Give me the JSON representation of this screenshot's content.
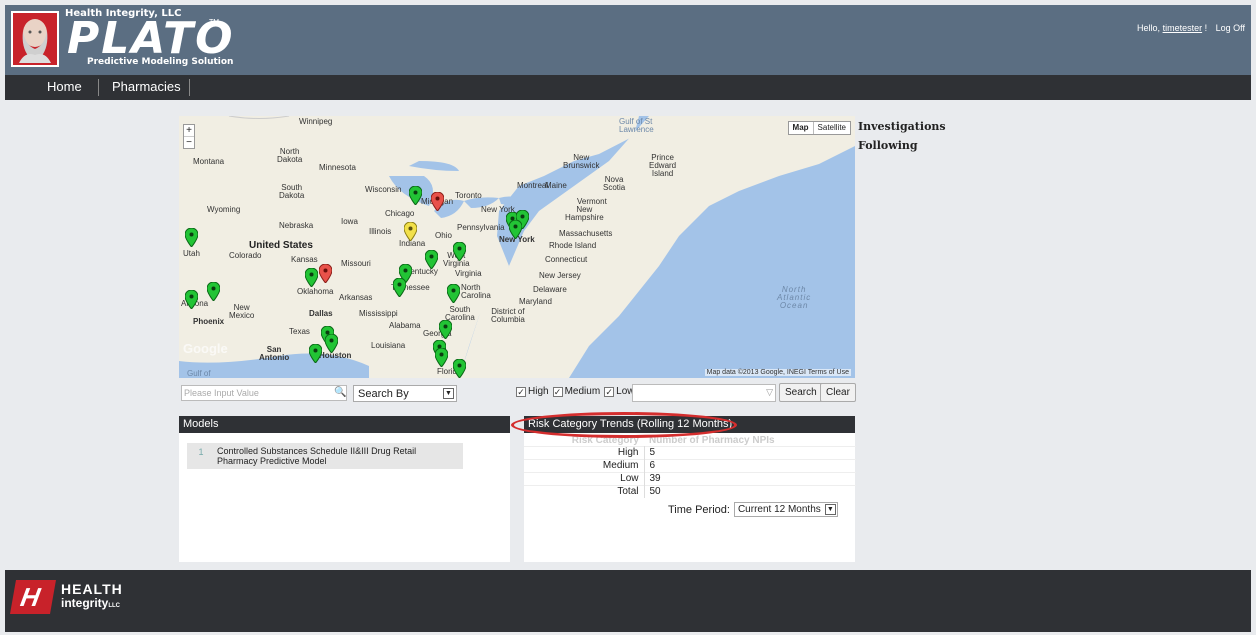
{
  "header": {
    "company": "Health Integrity, LLC",
    "brand": "PLATO",
    "tm": "TM",
    "tagline": "Predictive Modeling Solution",
    "greeting": "Hello,",
    "username": "timetester",
    "exclaim": "!",
    "logoff": "Log Off"
  },
  "nav": {
    "items": [
      "Home",
      "Pharmacies"
    ]
  },
  "map": {
    "type_buttons": [
      "Map",
      "Satellite"
    ],
    "zoom_in": "+",
    "zoom_out": "−",
    "attribution": "Map data ©2013 Google, INEGI    Terms of Use",
    "google": "Google",
    "labels": {
      "winnipeg": "Winnipeg",
      "gulf_st_lawrence": "Gulf of St\nLawrence",
      "north_dakota": "North\nDakota",
      "montana": "Montana",
      "minnesota": "Minnesota",
      "south_dakota": "South\nDakota",
      "wisconsin": "Wisconsin",
      "michigan": "Michigan",
      "toronto": "Toronto",
      "montreal": "Montreal",
      "maine": "Maine",
      "new_brunswick": "New\nBrunswick",
      "pei": "Prince\nEdward\nIsland",
      "nova_scotia": "Nova\nScotia",
      "wyoming": "Wyoming",
      "iowa": "Iowa",
      "nebraska": "Nebraska",
      "chicago": "Chicago",
      "illinois": "Illinois",
      "indiana": "Indiana",
      "ohio": "Ohio",
      "pennsylvania": "Pennsylvania",
      "new_york_state": "New York",
      "vermont": "Vermont",
      "new_hampshire": "New\nHampshire",
      "massachusetts": "Massachusetts",
      "rhode_island": "Rhode Island",
      "connecticut": "Connecticut",
      "new_jersey": "New Jersey",
      "delaware": "Delaware",
      "maryland": "Maryland",
      "dc": "District of\nColumbia",
      "new_york_city": "New York",
      "united_states": "United States",
      "utah": "Utah",
      "colorado": "Colorado",
      "kansas": "Kansas",
      "missouri": "Missouri",
      "kentucky": "Kentucky",
      "west_virginia": "West\nVirginia",
      "virginia": "Virginia",
      "oklahoma": "Oklahoma",
      "arkansas": "Arkansas",
      "tennessee": "Tennessee",
      "north_carolina": "North\nCarolina",
      "south_carolina": "South\nCarolina",
      "arizona": "Arizona",
      "new_mexico": "New\nMexico",
      "phoenix": "Phoenix",
      "dallas": "Dallas",
      "mississippi": "Mississippi",
      "alabama": "Alabama",
      "georgia": "Georgia",
      "texas": "Texas",
      "louisiana": "Louisiana",
      "san_antonio": "San\nAntonio",
      "houston": "Houston",
      "florida": "Florida",
      "gulf": "Gulf of",
      "ocean": "North\nAtlantic\nOcean"
    }
  },
  "search": {
    "placeholder": "Please Input Value",
    "search_by": "Search By",
    "check_high": "High",
    "check_medium": "Medium",
    "check_low": "Low",
    "search_btn": "Search",
    "clear_btn": "Clear"
  },
  "models": {
    "title": "Models",
    "rows": [
      {
        "num": "1",
        "name": "Controlled Substances Schedule II&III Drug Retail Pharmacy Predictive Model"
      }
    ]
  },
  "risk": {
    "title": "Risk Category Trends (Rolling 12 Months)",
    "col_category": "Risk Category",
    "col_count": "Number of Pharmacy NPIs",
    "rows": [
      {
        "label": "High",
        "value": "5"
      },
      {
        "label": "Medium",
        "value": "6"
      },
      {
        "label": "Low",
        "value": "39"
      },
      {
        "label": "Total",
        "value": "50"
      }
    ],
    "time_label": "Time Period:",
    "time_value": "Current 12 Months"
  },
  "sidebar": {
    "investigations": "Investigations",
    "following": "Following"
  },
  "footer": {
    "line1": "HEALTH",
    "line2": "integrity",
    "suffix": "LLC"
  },
  "colors": {
    "header_bg": "#5b6e82",
    "nav_bg": "#2f3135",
    "pin_green": "#22c435",
    "pin_red": "#e8524a",
    "pin_yellow": "#f2e04a",
    "highlight": "#d42e2e"
  }
}
